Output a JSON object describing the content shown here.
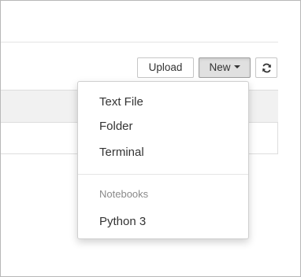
{
  "toolbar": {
    "upload_label": "Upload",
    "new_label": "New",
    "refresh_icon": "refresh-icon"
  },
  "new_menu": {
    "items": [
      {
        "label": "Text File"
      },
      {
        "label": "Folder"
      },
      {
        "label": "Terminal"
      }
    ],
    "section_header": "Notebooks",
    "notebook_items": [
      {
        "label": "Python 3"
      }
    ]
  },
  "colors": {
    "new_button_active_bg": "#e0e0e0",
    "menu_header_text": "#8a8a8a",
    "text": "#333333"
  }
}
